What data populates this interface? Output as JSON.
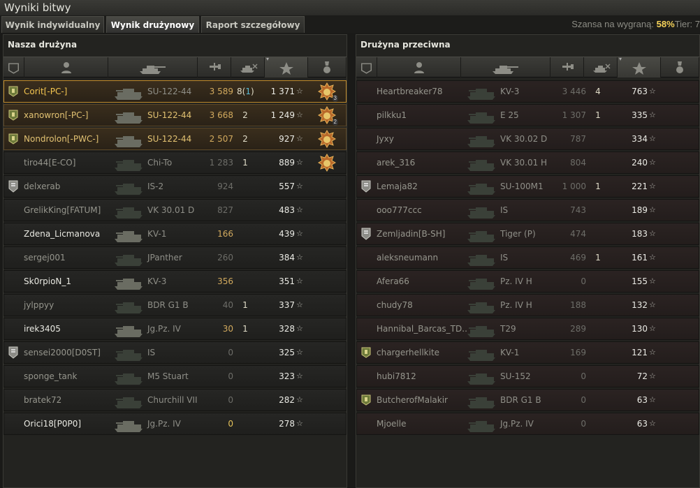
{
  "window": {
    "title": "Wyniki bitwy"
  },
  "tabs": [
    {
      "label": "Wynik indywidualny"
    },
    {
      "label": "Wynik drużynowy"
    },
    {
      "label": "Raport szczegółowy"
    }
  ],
  "win_chance": {
    "label": "Szansa na wygraną:",
    "value": "58%",
    "tier_label": "Tier: 7"
  },
  "teams": {
    "ours": {
      "title": "Nasza drużyna",
      "rows": [
        {
          "name": "Corit[-PC-]",
          "vehicle": "SU-122-44",
          "damage": "3 589",
          "kills": "8",
          "assist": "1",
          "xp": "1 371",
          "state": "me",
          "platoon": true,
          "dmg_style": "hi",
          "medal": "3"
        },
        {
          "name": "xanowron[-PC-]",
          "vehicle": "SU-122-44",
          "damage": "3 668",
          "kills": "2",
          "assist": "",
          "xp": "1 249",
          "state": "plat",
          "platoon": true,
          "dmg_style": "hi",
          "medal": "2"
        },
        {
          "name": "Nondrolon[-PWC-]",
          "vehicle": "SU-122-44",
          "damage": "2 507",
          "kills": "2",
          "assist": "",
          "xp": "927",
          "state": "plat",
          "platoon": true,
          "dmg_style": "hi",
          "medal": ""
        },
        {
          "name": "tiro44[E-CO]",
          "vehicle": "Chi-To",
          "damage": "1 283",
          "kills": "1",
          "assist": "",
          "xp": "889",
          "state": "dead",
          "platoon": false,
          "dmg_style": "",
          "medal": ""
        },
        {
          "name": "delxerab",
          "vehicle": "IS-2",
          "damage": "924",
          "kills": "",
          "assist": "",
          "xp": "557",
          "state": "dead",
          "platoon": false,
          "rank": true,
          "dmg_style": ""
        },
        {
          "name": "GrelikKing[FATUM]",
          "vehicle": "VK 30.01 D",
          "damage": "827",
          "kills": "",
          "assist": "",
          "xp": "483",
          "state": "dead",
          "platoon": false,
          "dmg_style": ""
        },
        {
          "name": "Zdena_Licmanova",
          "vehicle": "KV-1",
          "damage": "166",
          "kills": "",
          "assist": "",
          "xp": "439",
          "state": "alive",
          "platoon": false,
          "dmg_style": "hi"
        },
        {
          "name": "sergej001",
          "vehicle": "JPanther",
          "damage": "260",
          "kills": "",
          "assist": "",
          "xp": "384",
          "state": "dead",
          "platoon": false,
          "dmg_style": ""
        },
        {
          "name": "Sk0rpioN_1",
          "vehicle": "KV-3",
          "damage": "356",
          "kills": "",
          "assist": "",
          "xp": "351",
          "state": "alive",
          "platoon": false,
          "dmg_style": "hi"
        },
        {
          "name": "jylppyy",
          "vehicle": "BDR G1 B",
          "damage": "40",
          "kills": "1",
          "assist": "",
          "xp": "337",
          "state": "dead",
          "platoon": false,
          "dmg_style": ""
        },
        {
          "name": "irek3405",
          "vehicle": "Jg.Pz. IV",
          "damage": "30",
          "kills": "1",
          "assist": "",
          "xp": "328",
          "state": "alive",
          "platoon": false,
          "dmg_style": "hi"
        },
        {
          "name": "sensei2000[D0ST]",
          "vehicle": "IS",
          "damage": "0",
          "kills": "",
          "assist": "",
          "xp": "325",
          "state": "dead",
          "platoon": false,
          "rank": true,
          "dmg_style": ""
        },
        {
          "name": "sponge_tank",
          "vehicle": "M5 Stuart",
          "damage": "0",
          "kills": "",
          "assist": "",
          "xp": "323",
          "state": "dead",
          "platoon": false,
          "dmg_style": ""
        },
        {
          "name": "bratek72",
          "vehicle": "Churchill VII",
          "damage": "0",
          "kills": "",
          "assist": "",
          "xp": "282",
          "state": "dead",
          "platoon": false,
          "dmg_style": ""
        },
        {
          "name": "Orici18[P0P0]",
          "vehicle": "Jg.Pz. IV",
          "damage": "0",
          "kills": "",
          "assist": "",
          "xp": "278",
          "state": "alive",
          "platoon": false,
          "dmg_style": "yl"
        }
      ]
    },
    "enemy": {
      "title": "Drużyna przeciwna",
      "rows": [
        {
          "name": "Heartbreaker78",
          "vehicle": "KV-3",
          "damage": "3 446",
          "kills": "4",
          "assist": "",
          "xp": "763",
          "state": "dead",
          "dmg_style": ""
        },
        {
          "name": "pilkku1",
          "vehicle": "E 25",
          "damage": "1 307",
          "kills": "1",
          "assist": "",
          "xp": "335",
          "state": "dead",
          "dmg_style": ""
        },
        {
          "name": "Jyxy",
          "vehicle": "VK 30.02 D",
          "damage": "787",
          "kills": "",
          "assist": "",
          "xp": "334",
          "state": "dead",
          "dmg_style": ""
        },
        {
          "name": "arek_316",
          "vehicle": "VK 30.01 H",
          "damage": "804",
          "kills": "",
          "assist": "",
          "xp": "240",
          "state": "dead",
          "dmg_style": ""
        },
        {
          "name": "Lemaja82",
          "vehicle": "SU-100M1",
          "damage": "1 000",
          "kills": "1",
          "assist": "",
          "xp": "221",
          "state": "dead",
          "rank": true,
          "dmg_style": ""
        },
        {
          "name": "ooo777ccc",
          "vehicle": "IS",
          "damage": "743",
          "kills": "",
          "assist": "",
          "xp": "189",
          "state": "dead",
          "dmg_style": ""
        },
        {
          "name": "Zemljadin[B-SH]",
          "vehicle": "Tiger (P)",
          "damage": "474",
          "kills": "",
          "assist": "",
          "xp": "183",
          "state": "dead",
          "rank": true,
          "dmg_style": ""
        },
        {
          "name": "aleksneumann",
          "vehicle": "IS",
          "damage": "469",
          "kills": "1",
          "assist": "",
          "xp": "161",
          "state": "dead",
          "dmg_style": ""
        },
        {
          "name": "Afera66",
          "vehicle": "Pz. IV H",
          "damage": "0",
          "kills": "",
          "assist": "",
          "xp": "155",
          "state": "dead",
          "dmg_style": ""
        },
        {
          "name": "chudy78",
          "vehicle": "Pz. IV H",
          "damage": "188",
          "kills": "",
          "assist": "",
          "xp": "132",
          "state": "dead",
          "dmg_style": ""
        },
        {
          "name": "Hannibal_Barcas_TD..",
          "vehicle": "T29",
          "damage": "289",
          "kills": "",
          "assist": "",
          "xp": "130",
          "state": "dead",
          "dmg_style": ""
        },
        {
          "name": "chargerhellkite",
          "vehicle": "KV-1",
          "damage": "169",
          "kills": "",
          "assist": "",
          "xp": "121",
          "state": "dead",
          "platoon": true,
          "dmg_style": ""
        },
        {
          "name": "hubi7812",
          "vehicle": "SU-152",
          "damage": "0",
          "kills": "",
          "assist": "",
          "xp": "72",
          "state": "dead",
          "dmg_style": ""
        },
        {
          "name": "ButcherofMalakir",
          "vehicle": "BDR G1 B",
          "damage": "0",
          "kills": "",
          "assist": "",
          "xp": "63",
          "state": "dead",
          "platoon": true,
          "dmg_style": ""
        },
        {
          "name": "Mjoelle",
          "vehicle": "Jg.Pz. IV",
          "damage": "0",
          "kills": "",
          "assist": "",
          "xp": "63",
          "state": "dead",
          "dmg_style": ""
        }
      ]
    }
  },
  "icons": {
    "platoon": "platoon-icon",
    "rank": "rank-icon",
    "player": "player-icon",
    "tank": "tank-icon",
    "damage": "damage-icon",
    "kills": "kills-icon",
    "xp_star": "star-icon",
    "medal": "medal-icon"
  },
  "colors": {
    "accent": "#f5d25a",
    "assist": "#58bcd8",
    "platoon_gold": "#e2c272"
  }
}
